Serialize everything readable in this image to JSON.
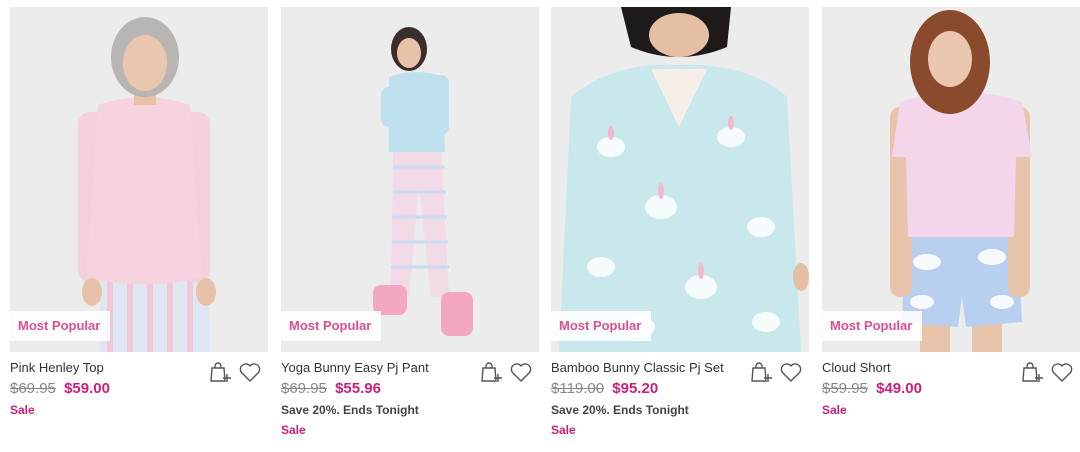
{
  "products": [
    {
      "title": "Pink Henley Top",
      "old_price": "$69.95",
      "new_price": "$59.00",
      "badge": "Most Popular",
      "promo": "",
      "sale": "Sale"
    },
    {
      "title": "Yoga Bunny Easy Pj Pant",
      "old_price": "$69.95",
      "new_price": "$55.96",
      "badge": "Most Popular",
      "promo": "Save 20%. Ends Tonight",
      "sale": "Sale"
    },
    {
      "title": "Bamboo Bunny Classic Pj Set",
      "old_price": "$119.00",
      "new_price": "$95.20",
      "badge": "Most Popular",
      "promo": "Save 20%. Ends Tonight",
      "sale": "Sale"
    },
    {
      "title": "Cloud Short",
      "old_price": "$59.95",
      "new_price": "$49.00",
      "badge": "Most Popular",
      "promo": "",
      "sale": "Sale"
    }
  ],
  "icons": {
    "add_to_bag": "add-to-bag-icon",
    "wishlist": "heart-icon"
  },
  "colors": {
    "badge_text": "#e0508f",
    "sale_price": "#cc1f7a",
    "image_bg": "#ececec"
  }
}
